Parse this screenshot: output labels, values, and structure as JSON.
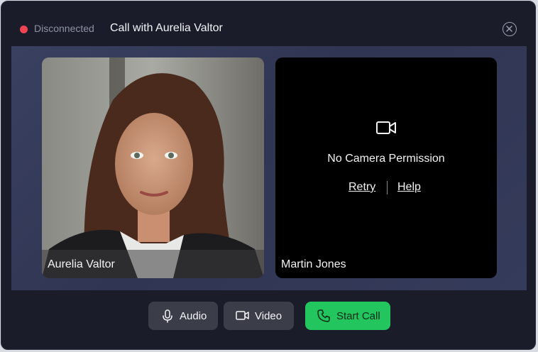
{
  "header": {
    "status_text": "Disconnected",
    "title": "Call with Aurelia Valtor",
    "close_icon": "close-icon"
  },
  "participants": {
    "left": {
      "name": "Aurelia Valtor",
      "video": "on"
    },
    "right": {
      "name": "Martin Jones",
      "video": "off",
      "camera_icon": "video-camera-icon",
      "message": "No Camera Permission",
      "retry_label": "Retry",
      "help_label": "Help"
    }
  },
  "controls": {
    "audio_label": "Audio",
    "video_label": "Video",
    "start_call_label": "Start Call",
    "audio_icon": "microphone-icon",
    "video_icon": "video-camera-icon",
    "call_icon": "phone-icon"
  },
  "colors": {
    "status_dot": "#ef4452",
    "start_call": "#22c55e",
    "window_bg": "#1a1d29"
  }
}
